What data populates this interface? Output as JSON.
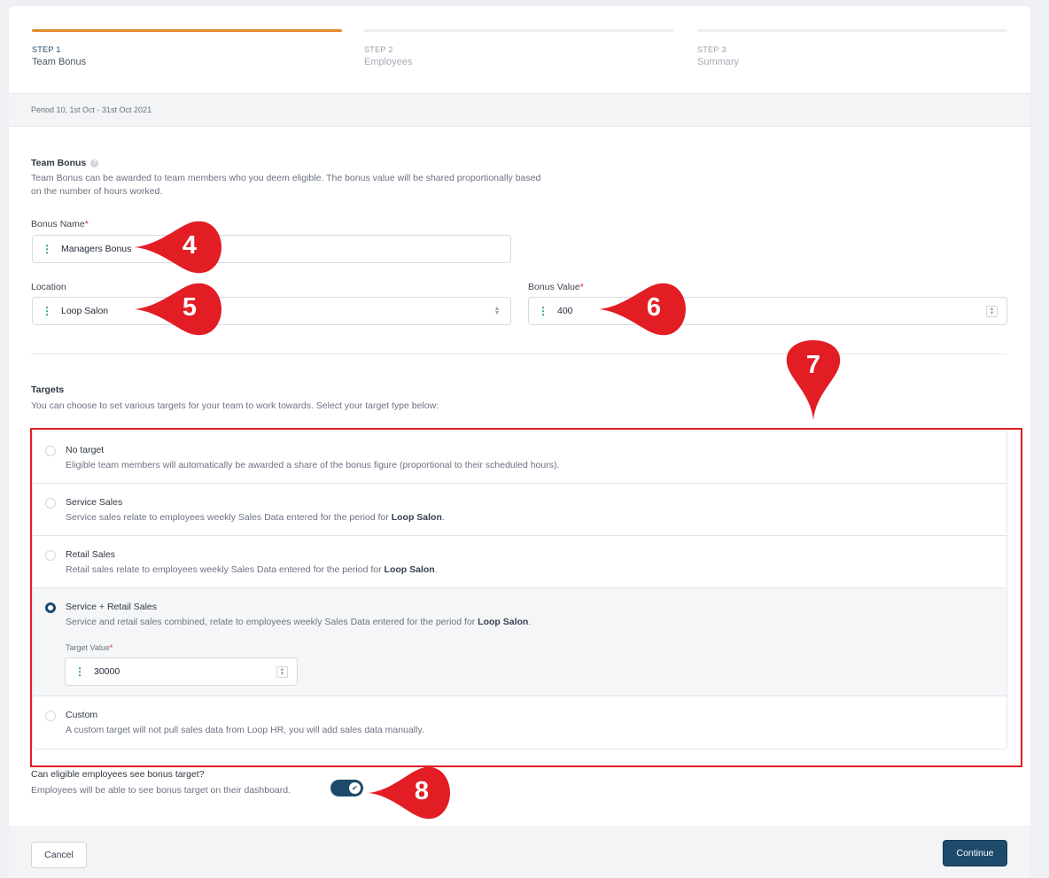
{
  "steps": [
    {
      "num": "STEP 1",
      "label": "Team Bonus",
      "active": true
    },
    {
      "num": "STEP 2",
      "label": "Employees",
      "active": false
    },
    {
      "num": "STEP 3",
      "label": "Summary",
      "active": false
    }
  ],
  "period": "Period 10, 1st Oct - 31st Oct 2021",
  "team_bonus": {
    "title": "Team Bonus",
    "help_icon": "?",
    "desc_line1": "Team Bonus can be awarded to team members who you deem eligible. The bonus value will be shared proportionally based",
    "desc_line2": "on the number of hours worked."
  },
  "bonus_name": {
    "label": "Bonus Name",
    "required": "*",
    "value": "Managers Bonus"
  },
  "location": {
    "label": "Location",
    "value": "Loop Salon"
  },
  "bonus_value": {
    "label": "Bonus Value",
    "required": "*",
    "value": "400"
  },
  "targets": {
    "title": "Targets",
    "desc": "You can choose to set various targets for your team to work towards. Select your target type below:",
    "options": [
      {
        "title": "No target",
        "desc": "Eligible team members will automatically be awarded a share of the bonus figure (proportional to their scheduled hours).",
        "bold": "",
        "end": "",
        "selected": false
      },
      {
        "title": "Service Sales",
        "desc": "Service sales relate to employees weekly Sales Data entered for the period for ",
        "bold": "Loop Salon",
        "end": ".",
        "selected": false
      },
      {
        "title": "Retail Sales",
        "desc": "Retail sales relate to employees weekly Sales Data entered for the period for ",
        "bold": "Loop Salon",
        "end": ".",
        "selected": false
      },
      {
        "title": "Service + Retail Sales",
        "desc": "Service and retail sales combined, relate to employees weekly Sales Data entered for the period for ",
        "bold": "Loop Salon",
        "end": ".",
        "selected": true
      },
      {
        "title": "Custom",
        "desc": "A custom target will not pull sales data from Loop HR, you will add sales data manually.",
        "bold": "",
        "end": "",
        "selected": false
      }
    ],
    "target_value": {
      "label": "Target Value",
      "required": "*",
      "value": "30000"
    }
  },
  "visibility": {
    "title": "Can eligible employees see bonus target?",
    "desc": "Employees will be able to see bonus target on their dashboard.",
    "enabled": true,
    "check": "✔"
  },
  "footer": {
    "cancel": "Cancel",
    "continue": "Continue"
  },
  "callouts": {
    "c4": "4",
    "c5": "5",
    "c6": "6",
    "c7": "7",
    "c8": "8"
  },
  "colors": {
    "accent": "#1e4a6b",
    "step_active": "#e08a2a",
    "callout": "#e21d24",
    "drag_handle": "#22a35a"
  }
}
